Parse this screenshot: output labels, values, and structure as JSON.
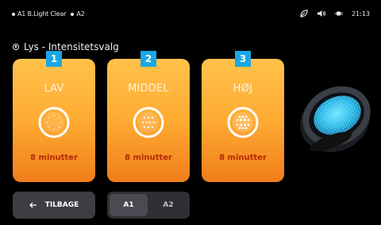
{
  "status": {
    "zone1": "A1 B.Light Clear",
    "zone2": "A2",
    "time": "21:13",
    "icons": [
      "leaf-icon",
      "speaker-icon",
      "plug-icon"
    ]
  },
  "page": {
    "title": "Lys - Intensitetsvalg"
  },
  "cards": [
    {
      "number": "1",
      "label": "LAV",
      "duration": "8 minutter",
      "level": "low"
    },
    {
      "number": "2",
      "label": "MIDDEL",
      "duration": "8 minutter",
      "level": "medium"
    },
    {
      "number": "3",
      "label": "HØJ",
      "duration": "8 minutter",
      "level": "high"
    }
  ],
  "footer": {
    "back_label": "TILBAGE",
    "segments": [
      "A1",
      "A2"
    ],
    "selected_segment": "A1"
  },
  "colors": {
    "card_gradient_top": "#ffc24a",
    "card_gradient_bottom": "#f07d1a",
    "badge": "#1aa7e6",
    "duration_text": "#b52a00",
    "button_bg": "#3d3d44"
  }
}
